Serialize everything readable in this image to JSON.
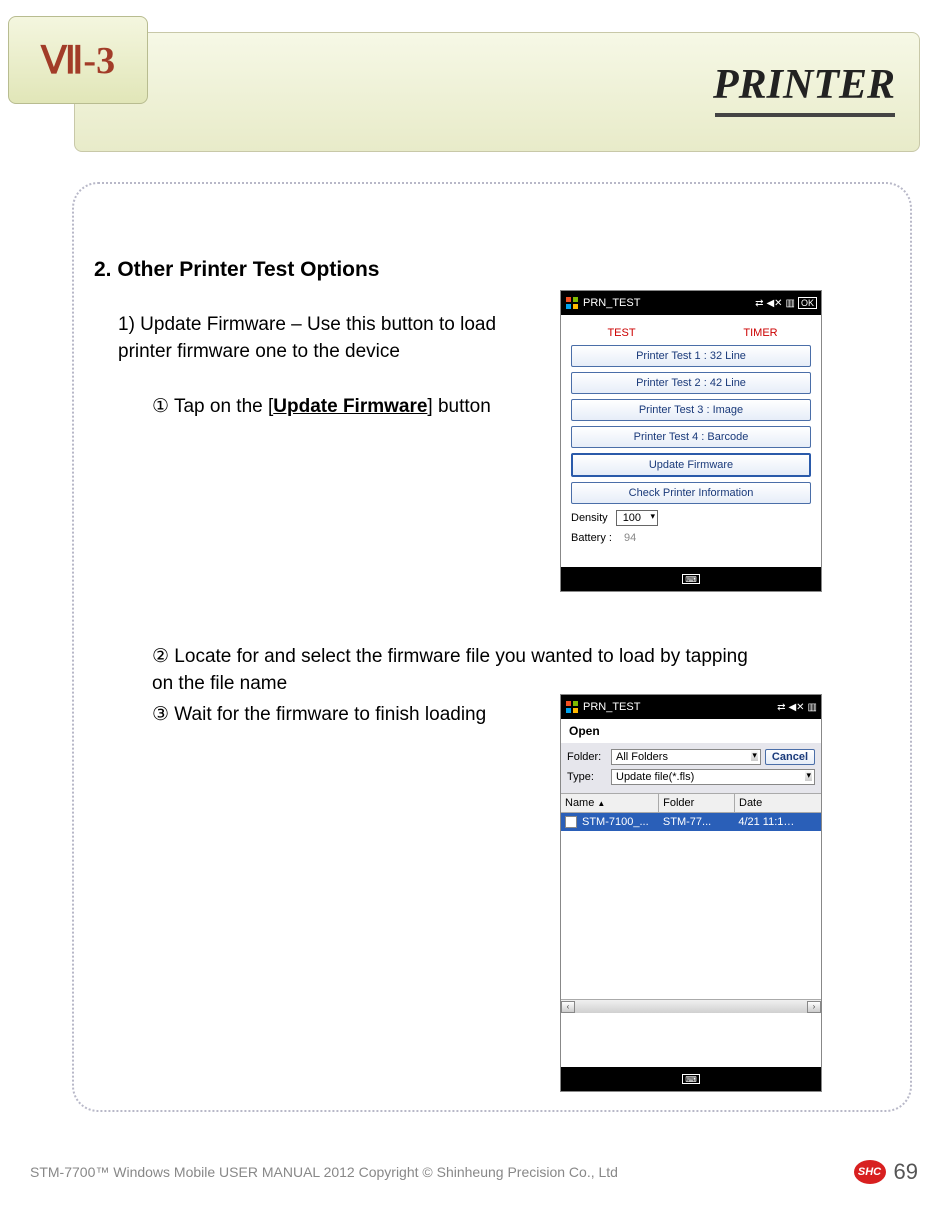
{
  "chapter": "Ⅶ-3",
  "header_title": "PRINTER",
  "section_title": "2. Other Printer Test Options",
  "para1": "1) Update Firmware – Use this button to load printer firmware one to the device",
  "step1_prefix": "① Tap on the [",
  "step1_bold": "Update Firmware",
  "step1_suffix": "] button",
  "step2": "② Locate for and select the firmware file you wanted to load by tapping on the file name",
  "step3": "③ Wait for the firmware to finish loading",
  "shot1": {
    "title": "PRN_TEST",
    "ok": "OK",
    "label_test": "TEST",
    "label_timer": "TIMER",
    "btn1": "Printer Test 1 : 32 Line",
    "btn2": "Printer Test 2 : 42 Line",
    "btn3": "Printer Test 3 : Image",
    "btn4": "Printer Test 4 : Barcode",
    "btn5": "Update Firmware",
    "btn6": "Check Printer Information",
    "density_label": "Density",
    "density_value": "100",
    "battery_label": "Battery :",
    "battery_value": "94"
  },
  "shot2": {
    "title": "PRN_TEST",
    "open": "Open",
    "folder_label": "Folder:",
    "folder_value": "All Folders",
    "cancel": "Cancel",
    "type_label": "Type:",
    "type_value": "Update file(*.fls)",
    "col_name": "Name",
    "col_folder": "Folder",
    "col_date": "Date",
    "row_name": "STM-7100_...",
    "row_folder": "STM-77...",
    "row_date": "4/21 11:1…"
  },
  "footer_text": "STM-7700™ Windows Mobile USER MANUAL  2012 Copyright © Shinheung Precision Co., Ltd",
  "footer_badge": "SHC",
  "page_number": "69"
}
